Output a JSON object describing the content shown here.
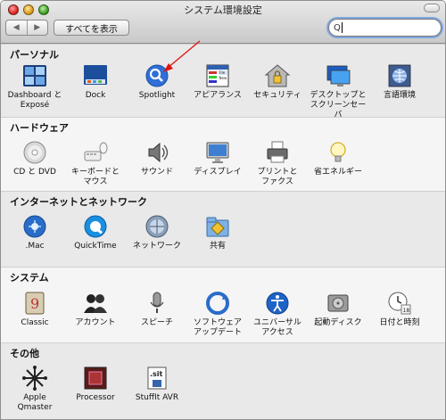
{
  "window": {
    "title": "システム環境設定"
  },
  "toolbar": {
    "back_label": "◀",
    "forward_label": "▶",
    "show_all_label": "すべてを表示",
    "search_value": "",
    "search_icon_glyph": "Q"
  },
  "sections": {
    "personal": {
      "title": "パーソナル",
      "items": [
        {
          "label": "Dashboard と\nExposé",
          "icon": "dashboard-icon"
        },
        {
          "label": "Dock",
          "icon": "dock-icon"
        },
        {
          "label": "Spotlight",
          "icon": "spotlight-icon"
        },
        {
          "label": "アピアランス",
          "icon": "appearance-icon"
        },
        {
          "label": "セキュリティ",
          "icon": "security-icon"
        },
        {
          "label": "デスクトップと\nスクリーンセーバ",
          "icon": "desktop-icon"
        },
        {
          "label": "言語環境",
          "icon": "language-icon"
        }
      ]
    },
    "hardware": {
      "title": "ハードウェア",
      "items": [
        {
          "label": "CD と DVD",
          "icon": "cd-icon"
        },
        {
          "label": "キーボードと\nマウス",
          "icon": "keyboard-icon"
        },
        {
          "label": "サウンド",
          "icon": "sound-icon"
        },
        {
          "label": "ディスプレイ",
          "icon": "display-icon"
        },
        {
          "label": "プリントと\nファクス",
          "icon": "printer-icon"
        },
        {
          "label": "省エネルギー",
          "icon": "energy-icon"
        }
      ]
    },
    "internet": {
      "title": "インターネットとネットワーク",
      "items": [
        {
          "label": ".Mac",
          "icon": "mac-icon"
        },
        {
          "label": "QuickTime",
          "icon": "quicktime-icon"
        },
        {
          "label": "ネットワーク",
          "icon": "network-icon"
        },
        {
          "label": "共有",
          "icon": "sharing-icon"
        }
      ]
    },
    "system": {
      "title": "システム",
      "items": [
        {
          "label": "Classic",
          "icon": "classic-icon"
        },
        {
          "label": "アカウント",
          "icon": "accounts-icon"
        },
        {
          "label": "スピーチ",
          "icon": "speech-icon"
        },
        {
          "label": "ソフトウェア\nアップデート",
          "icon": "update-icon"
        },
        {
          "label": "ユニバーサル\nアクセス",
          "icon": "accessibility-icon"
        },
        {
          "label": "起動ディスク",
          "icon": "startup-disk-icon"
        },
        {
          "label": "日付と時刻",
          "icon": "clock-icon"
        }
      ]
    },
    "other": {
      "title": "その他",
      "items": [
        {
          "label": "Apple\nQmaster",
          "icon": "qmaster-icon"
        },
        {
          "label": "Processor",
          "icon": "processor-icon"
        },
        {
          "label": "StuffIt AVR",
          "icon": "stuffit-icon"
        }
      ]
    }
  },
  "icon_text": {
    "appearance_file": "File",
    "appearance_new": "New",
    "stuffit_text": ".sit",
    "clock_day": "18"
  }
}
